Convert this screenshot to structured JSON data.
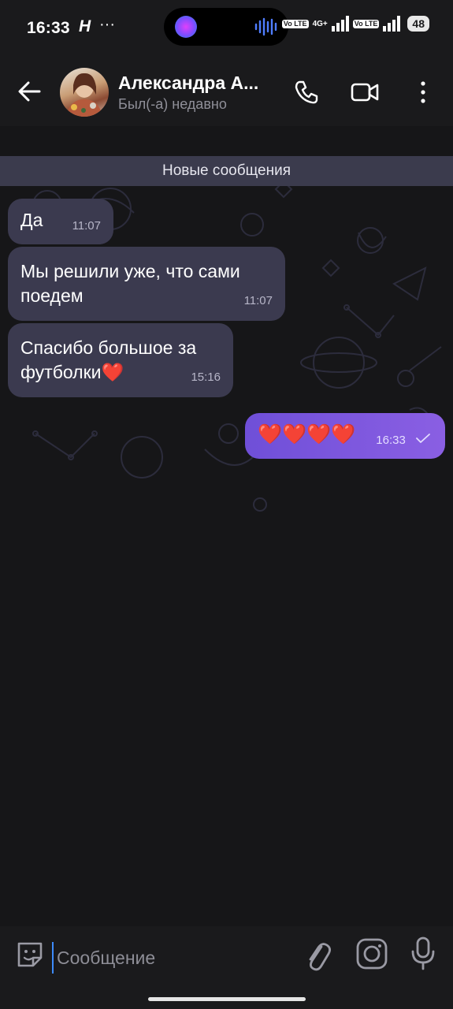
{
  "status_bar": {
    "time": "16:33",
    "carrier_icon_text": "H",
    "more": "···",
    "volte_label": "Vo LTE",
    "network_label": "4G+",
    "battery": "48"
  },
  "header": {
    "contact_name": "Александра А...",
    "contact_status": "Был(-а) недавно",
    "icons": [
      "back-arrow-icon",
      "phone-icon",
      "video-camera-icon",
      "more-vertical-icon"
    ]
  },
  "chat": {
    "new_messages_banner": "Новые сообщения",
    "messages": [
      {
        "direction": "in",
        "text": "Да",
        "time": "11:07"
      },
      {
        "direction": "in",
        "text": "Мы решили уже, что сами поедем",
        "time": "11:07"
      },
      {
        "direction": "in",
        "text": "Спасибо большое за футболки❤️",
        "time": "15:16"
      },
      {
        "direction": "out",
        "text": "❤️❤️❤️❤️",
        "time": "16:33",
        "status": "sent"
      }
    ]
  },
  "input": {
    "placeholder": "Сообщение",
    "icons": [
      "sticker-icon",
      "attach-paperclip-icon",
      "camera-icon",
      "microphone-icon"
    ]
  },
  "colors": {
    "background": "#161618",
    "incoming_bubble": "#3b3a4f",
    "outgoing_bubble": "#7b55dd",
    "banner": "#3b3b4d"
  }
}
